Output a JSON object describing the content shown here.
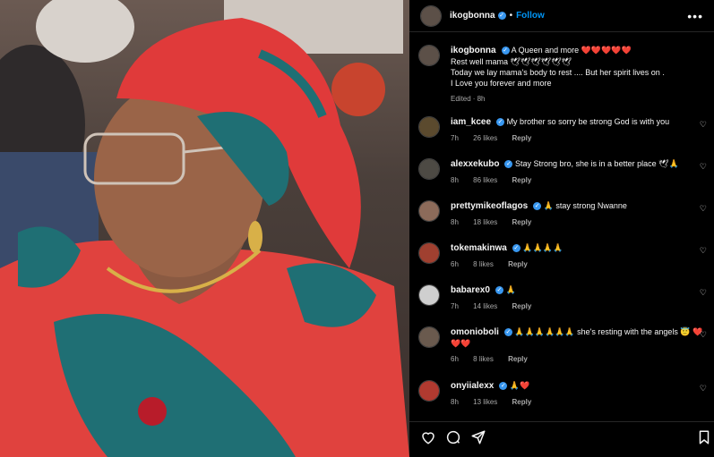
{
  "post": {
    "username": "ikogbonna",
    "follow_label": "Follow",
    "dot": "•",
    "more": "•••",
    "caption": {
      "line1": "A Queen and more",
      "hearts": "❤️❤️❤️❤️❤️",
      "line2": "Rest well mama",
      "doves": "🕊🕊🕊🕊🕊🕊",
      "line3": "Today we lay mama's body to rest .... But her spirit lives on .",
      "line4": "I Love you forever and more",
      "edited": "Edited",
      "age": "8h"
    }
  },
  "comments": [
    {
      "user": "iam_kcee",
      "text": "My brother so sorry be strong God is with you",
      "age": "7h",
      "likes": "26 likes",
      "reply": "Reply",
      "color": "#5b4a2e"
    },
    {
      "user": "alexxekubo",
      "text": "Stay Strong bro, she is in a better place 🕊🙏",
      "age": "8h",
      "likes": "86 likes",
      "reply": "Reply",
      "color": "#4d4a44"
    },
    {
      "user": "prettymikeoflagos",
      "text": "🙏 stay strong Nwanne",
      "age": "8h",
      "likes": "18 likes",
      "reply": "Reply",
      "color": "#8c6b5a"
    },
    {
      "user": "tokemakinwa",
      "text": "🙏🙏🙏🙏",
      "age": "6h",
      "likes": "8 likes",
      "reply": "Reply",
      "color": "#a04030"
    },
    {
      "user": "babarex0",
      "text": "🙏",
      "age": "7h",
      "likes": "14 likes",
      "reply": "Reply",
      "color": "#cfcfcf"
    },
    {
      "user": "omonioboli",
      "text": "🙏🙏🙏🙏🙏🙏 she's resting with the angels 😇 ❤️❤️❤️",
      "age": "6h",
      "likes": "8 likes",
      "reply": "Reply",
      "color": "#6a5a4e"
    },
    {
      "user": "onyiialexx",
      "text": "🙏❤️",
      "age": "8h",
      "likes": "13 likes",
      "reply": "Reply",
      "color": "#b03a30"
    }
  ],
  "icons": {
    "heart": "♡",
    "like": "heart-outline-icon",
    "comment": "comment-icon",
    "share": "send-icon",
    "save": "bookmark-icon"
  },
  "colors": {
    "link": "#0095f6",
    "verified": "#3897f0",
    "muted": "#a8a8a8",
    "background": "#000000"
  }
}
